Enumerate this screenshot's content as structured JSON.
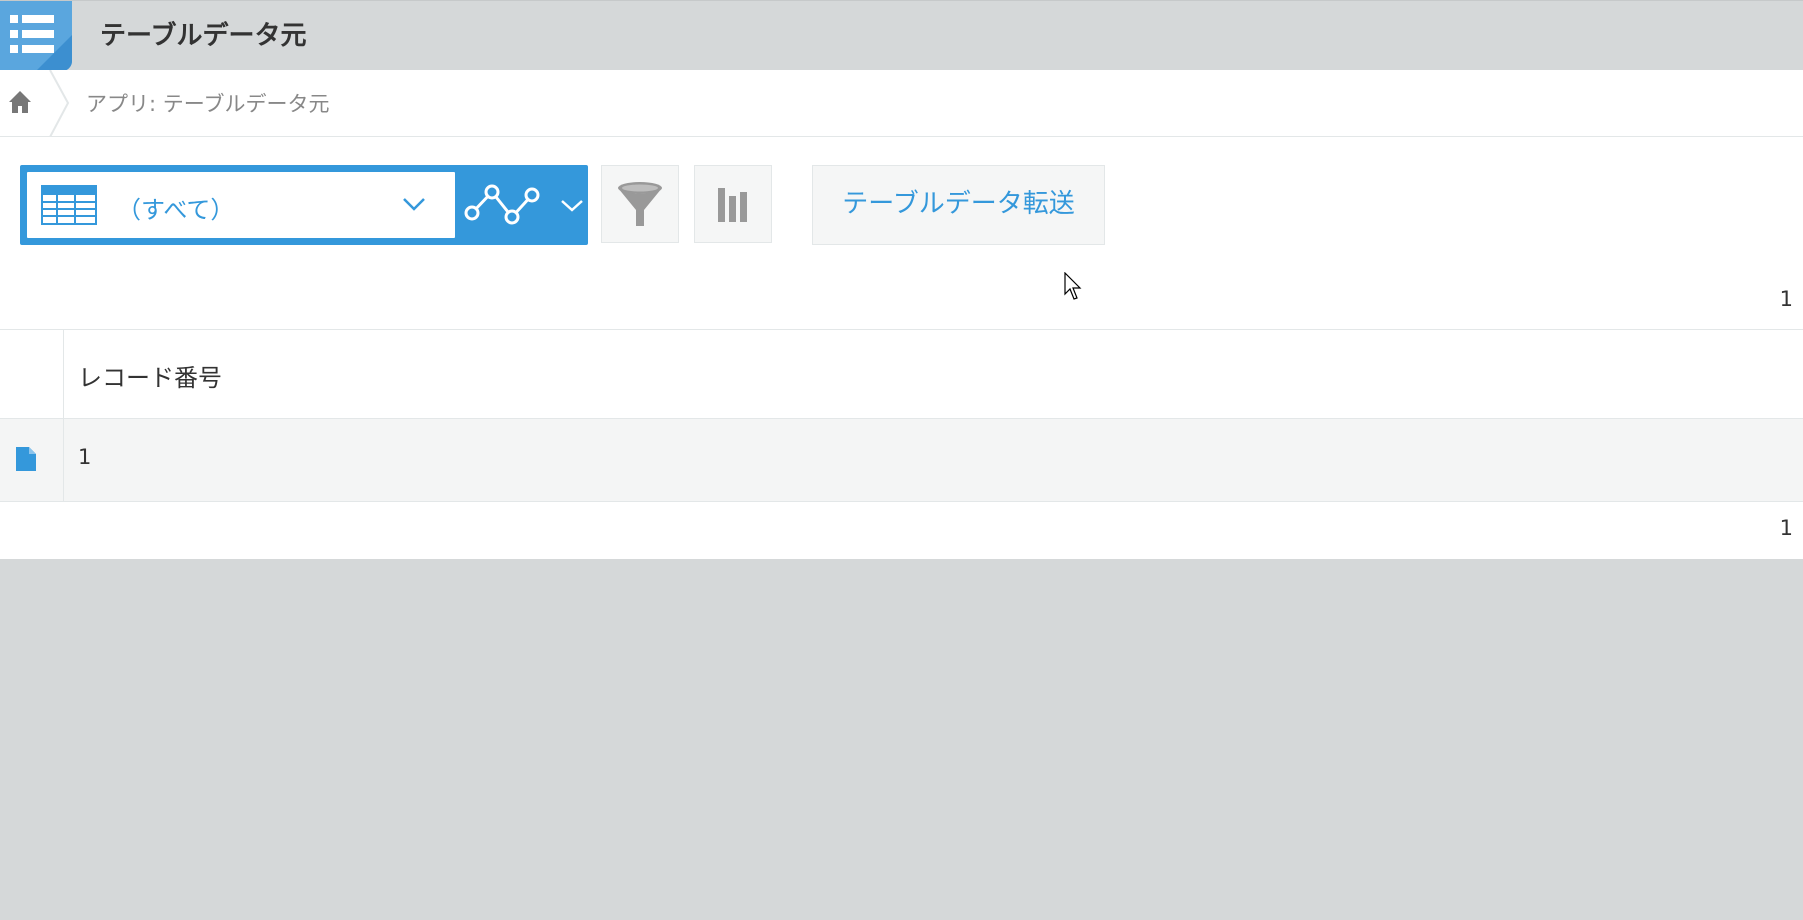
{
  "header": {
    "app_title": "テーブルデータ元",
    "app_icon": "list-icon"
  },
  "breadcrumb": {
    "home_icon": "home-icon",
    "text": "アプリ: テーブルデータ元"
  },
  "toolbar": {
    "view_select": {
      "value": "（すべて）",
      "icon": "table-icon"
    },
    "graph_icon": "graph-icon",
    "filter_icon": "filter-icon",
    "chart_icon": "bar-chart-icon",
    "transfer_label": "テーブルデータ転送"
  },
  "list": {
    "count_top": "1",
    "count_bottom": "1",
    "columns": [
      "レコード番号"
    ],
    "rows": [
      {
        "values": [
          "1"
        ]
      }
    ]
  },
  "colors": {
    "accent": "#3498db",
    "background": "#d5d8d9"
  }
}
